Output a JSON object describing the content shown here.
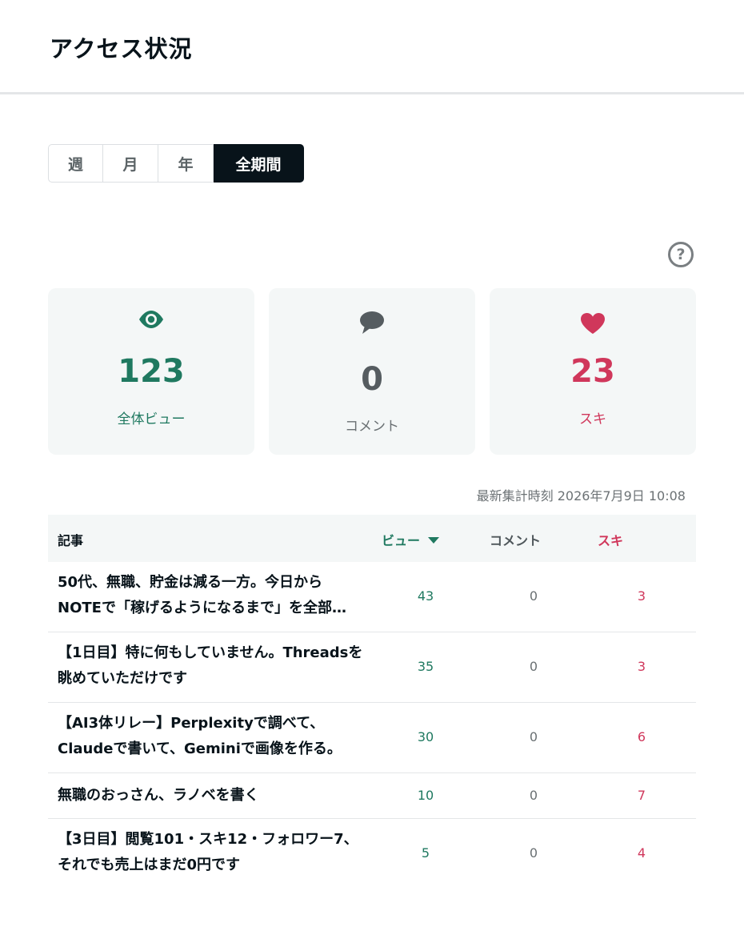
{
  "header": {
    "title": "アクセス状況"
  },
  "tabs": [
    {
      "label": "週"
    },
    {
      "label": "月"
    },
    {
      "label": "年"
    },
    {
      "label": "全期間",
      "active": true
    }
  ],
  "help": {
    "symbol": "?"
  },
  "stats": {
    "views": {
      "value": "123",
      "label": "全体ビュー",
      "color": "#1f7960",
      "icon": "eye-icon"
    },
    "comments": {
      "value": "0",
      "label": "コメント",
      "color": "#555c60",
      "icon": "comment-icon"
    },
    "likes": {
      "value": "23",
      "label": "スキ",
      "color": "#d0375b",
      "icon": "heart-icon"
    }
  },
  "updated": "最新集計時刻 2026年7月9日 10:08",
  "table": {
    "headers": {
      "article": "記事",
      "views": "ビュー",
      "comments": "コメント",
      "likes": "スキ"
    },
    "sorted_by": "views",
    "rows": [
      {
        "title": "50代、無職、貯金は減る一方。今日からNOTEで「稼げるようになるまで」を全部…",
        "views": "43",
        "comments": "0",
        "likes": "3"
      },
      {
        "title": "【1日目】特に何もしていません。Threadsを眺めていただけです",
        "views": "35",
        "comments": "0",
        "likes": "3"
      },
      {
        "title": "【AI3体リレー】Perplexityで調べて、Claudeで書いて、Geminiで画像を作る。",
        "views": "30",
        "comments": "0",
        "likes": "6"
      },
      {
        "title": "無職のおっさん、ラノベを書く",
        "views": "10",
        "comments": "0",
        "likes": "7"
      },
      {
        "title": "【3日目】閲覧101・スキ12・フォロワー7、それでも売上はまだ0円です",
        "views": "5",
        "comments": "0",
        "likes": "4"
      }
    ]
  }
}
